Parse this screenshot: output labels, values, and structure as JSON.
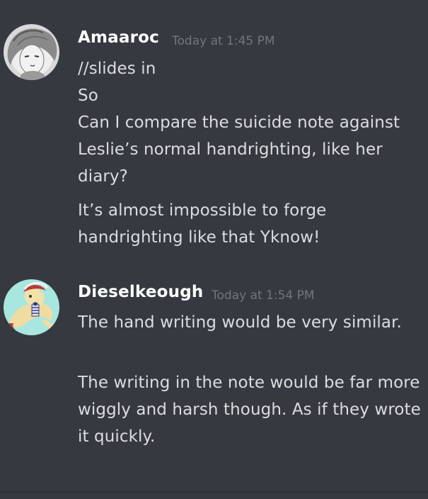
{
  "messages": [
    {
      "username": "Amaaroc",
      "timestamp": "Today at 1:45 PM",
      "avatar": "amaaroc-avatar",
      "lines": [
        "//slides in",
        "So",
        "Can I compare the suicide note against Leslie’s normal handrighting, like her diary?",
        "It’s almost impossible to forge handrighting like that Yknow!"
      ]
    },
    {
      "username": "Dieselkeough",
      "timestamp": "Today at 1:54 PM",
      "avatar": "dieselkeough-avatar",
      "lines": [
        "The hand writing would be very similar.",
        "The writing in the note would be far more wiggly and harsh though. As if they wrote it quickly."
      ]
    }
  ],
  "colors": {
    "background": "#36393f",
    "username": "#ffffff",
    "timestamp": "#72767d",
    "message_text": "#dcddde"
  }
}
